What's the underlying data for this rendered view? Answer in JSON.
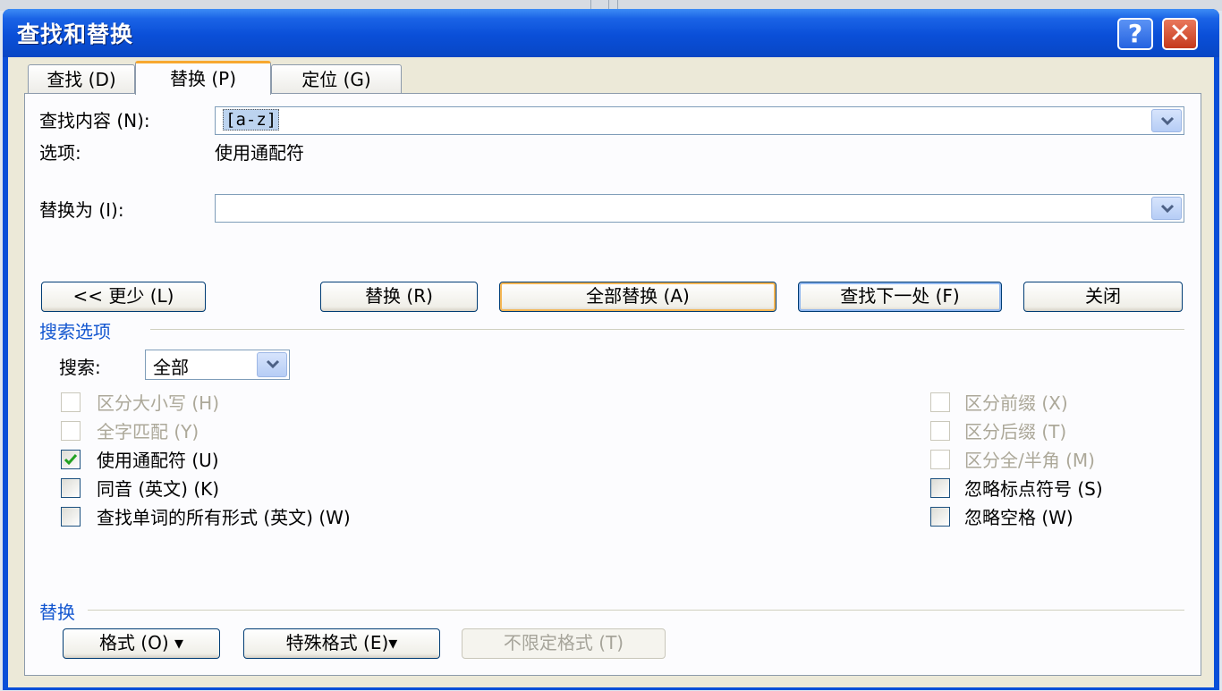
{
  "window": {
    "title": "查找和替换"
  },
  "tabs": [
    {
      "label": "查找 (D)",
      "active": false
    },
    {
      "label": "替换 (P)",
      "active": true
    },
    {
      "label": "定位 (G)",
      "active": false
    }
  ],
  "find": {
    "label": "查找内容 (N):",
    "value": "[a-z]",
    "options_label": "选项:",
    "options_value": "使用通配符"
  },
  "replace": {
    "label": "替换为 (I):",
    "value": ""
  },
  "buttons": {
    "less": "<< 更少 (L)",
    "replace": "替换 (R)",
    "replace_all": "全部替换 (A)",
    "find_next": "查找下一处 (F)",
    "close": "关闭"
  },
  "search_options": {
    "heading": "搜索选项",
    "search_label": "搜索:",
    "search_value": "全部",
    "left": [
      {
        "label": "区分大小写 (H)",
        "checked": false,
        "enabled": false
      },
      {
        "label": "全字匹配 (Y)",
        "checked": false,
        "enabled": false
      },
      {
        "label": "使用通配符 (U)",
        "checked": true,
        "enabled": true
      },
      {
        "label": "同音 (英文) (K)",
        "checked": false,
        "enabled": true
      },
      {
        "label": "查找单词的所有形式 (英文) (W)",
        "checked": false,
        "enabled": true
      }
    ],
    "right": [
      {
        "label": "区分前缀 (X)",
        "checked": false,
        "enabled": false
      },
      {
        "label": "区分后缀 (T)",
        "checked": false,
        "enabled": false
      },
      {
        "label": "区分全/半角 (M)",
        "checked": false,
        "enabled": false
      },
      {
        "label": "忽略标点符号 (S)",
        "checked": false,
        "enabled": true
      },
      {
        "label": "忽略空格 (W)",
        "checked": false,
        "enabled": true
      }
    ]
  },
  "replace_section": {
    "heading": "替换",
    "format": "格式 (O) ▾",
    "special": "特殊格式 (E)▾",
    "no_format": "不限定格式 (T)"
  },
  "colors": {
    "titlebar": "#0a4fd8",
    "group_heading": "#1457d0",
    "default_button_ring": "#f4b552"
  },
  "icons": {
    "help": "help-icon",
    "close": "close-icon",
    "dropdown": "chevron-down-icon",
    "check": "check-icon"
  }
}
